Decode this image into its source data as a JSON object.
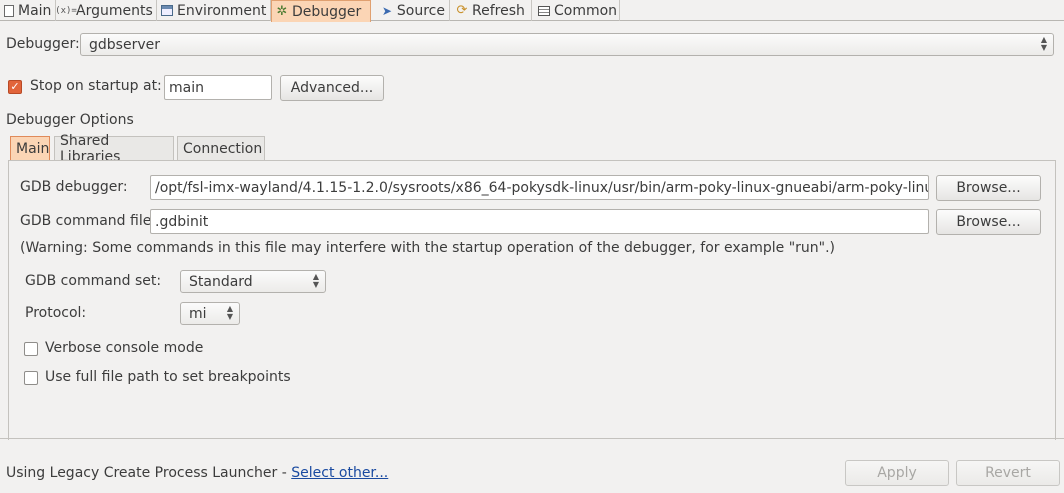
{
  "tabs": [
    {
      "label": "Main",
      "icon": "main-tab-icon"
    },
    {
      "label": "Arguments",
      "icon": "arguments-icon"
    },
    {
      "label": "Environment",
      "icon": "environment-icon"
    },
    {
      "label": "Debugger",
      "icon": "debugger-icon"
    },
    {
      "label": "Source",
      "icon": "source-icon"
    },
    {
      "label": "Refresh",
      "icon": "refresh-icon"
    },
    {
      "label": "Common",
      "icon": "common-icon"
    }
  ],
  "active_tab": "Debugger",
  "debugger": {
    "label": "Debugger:",
    "value": "gdbserver"
  },
  "stop_on_startup": {
    "label": "Stop on startup at:",
    "checked": true,
    "value": "main",
    "advanced_label": "Advanced..."
  },
  "options": {
    "group_label": "Debugger Options",
    "tabs": [
      "Main",
      "Shared Libraries",
      "Connection"
    ],
    "gdb_debugger_label": "GDB debugger:",
    "gdb_debugger_value": "/opt/fsl-imx-wayland/4.1.15-1.2.0/sysroots/x86_64-pokysdk-linux/usr/bin/arm-poky-linux-gnueabi/arm-poky-linux-g",
    "gdb_command_file_label": "GDB command file:",
    "gdb_command_file_value": ".gdbinit",
    "browse_label": "Browse...",
    "warning": "(Warning: Some commands in this file may interfere with the startup operation of the debugger, for example \"run\".)",
    "command_set_label": "GDB command set:",
    "command_set_value": "Standard",
    "protocol_label": "Protocol:",
    "protocol_value": "mi",
    "verbose_label": "Verbose console mode",
    "verbose_checked": false,
    "full_path_label": "Use full file path to set breakpoints",
    "full_path_checked": false
  },
  "footer": {
    "launcher_text": "Using Legacy Create Process Launcher - ",
    "select_other": "Select other...",
    "apply_label": "Apply",
    "revert_label": "Revert"
  },
  "colors": {
    "active_tab": "#fbd5b5",
    "checkbox_checked": "#e2643a",
    "link": "#1a4aa0"
  }
}
